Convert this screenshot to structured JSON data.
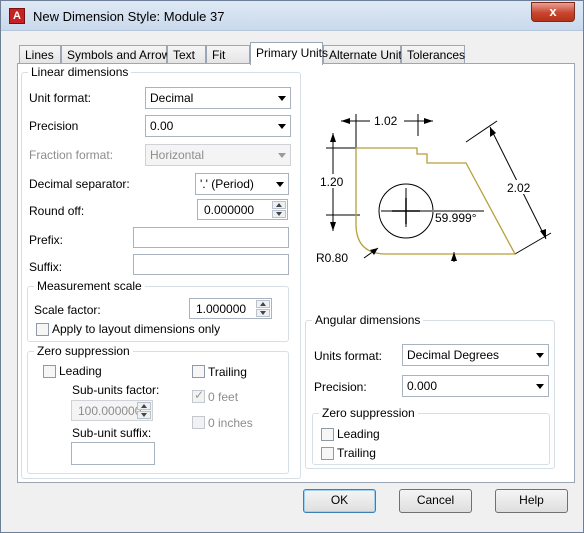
{
  "window": {
    "title": "New Dimension Style: Module 37",
    "close_label": "x"
  },
  "tabs": [
    "Lines",
    "Symbols and Arrows",
    "Text",
    "Fit",
    "Primary Units",
    "Alternate Units",
    "Tolerances"
  ],
  "active_tab": "Primary Units",
  "linear": {
    "title": "Linear dimensions",
    "unit_format_label": "Unit format:",
    "unit_format_value": "Decimal",
    "precision_label": "Precision",
    "precision_value": "0.00",
    "fraction_format_label": "Fraction format:",
    "fraction_format_value": "Horizontal",
    "decimal_separator_label": "Decimal separator:",
    "decimal_separator_value": "'.' (Period)",
    "round_off_label": "Round off:",
    "round_off_value": "0.000000",
    "prefix_label": "Prefix:",
    "prefix_value": "",
    "suffix_label": "Suffix:",
    "suffix_value": ""
  },
  "measurement": {
    "title": "Measurement scale",
    "scale_factor_label": "Scale factor:",
    "scale_factor_value": "1.000000",
    "apply_layout_label": "Apply to layout dimensions only",
    "apply_layout_checked": false
  },
  "zero_linear": {
    "title": "Zero suppression",
    "leading_label": "Leading",
    "leading_checked": false,
    "trailing_label": "Trailing",
    "trailing_checked": false,
    "subunits_factor_label": "Sub-units factor:",
    "subunits_factor_value": "100.000000",
    "subunit_suffix_label": "Sub-unit suffix:",
    "subunit_suffix_value": "",
    "feet_label": "0 feet",
    "feet_checked": true,
    "inches_label": "0 inches",
    "inches_checked": false
  },
  "angular": {
    "title": "Angular dimensions",
    "units_format_label": "Units format:",
    "units_format_value": "Decimal Degrees",
    "precision_label": "Precision:",
    "precision_value": "0.000",
    "zero_title": "Zero suppression",
    "leading_label": "Leading",
    "leading_checked": false,
    "trailing_label": "Trailing",
    "trailing_checked": false
  },
  "preview": {
    "dim_top": "1.02",
    "dim_left": "1.20",
    "dim_right": "2.02",
    "dim_angle": "59.999°",
    "dim_radius": "R0.80",
    "outline_color": "#b79f3b"
  },
  "buttons": {
    "ok": "OK",
    "cancel": "Cancel",
    "help": "Help"
  }
}
